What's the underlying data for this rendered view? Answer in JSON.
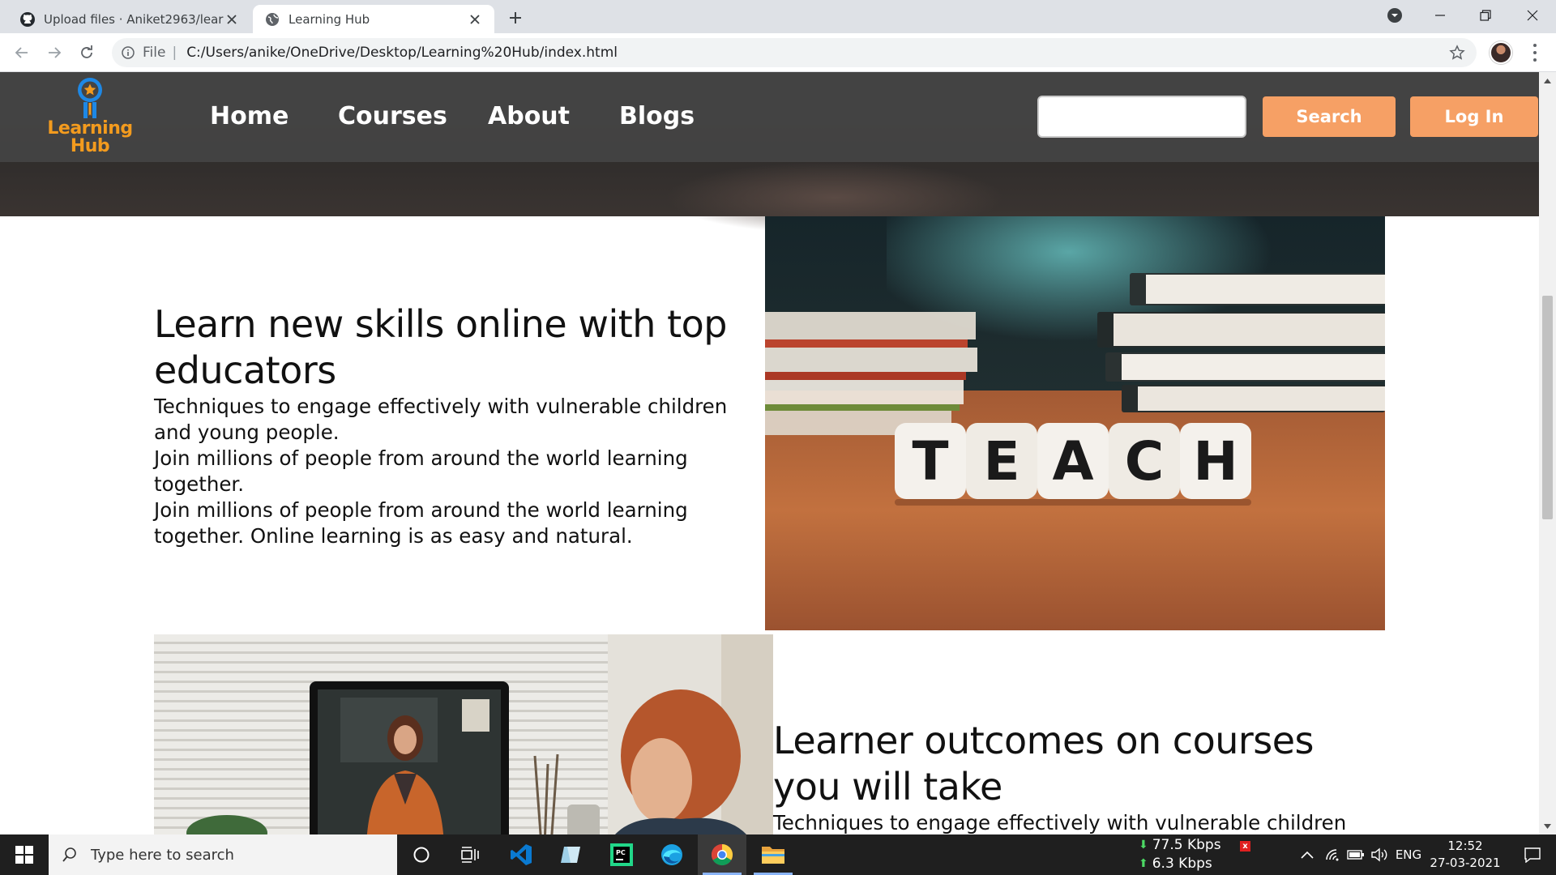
{
  "browser": {
    "tabs": [
      {
        "title": "Upload files · Aniket2963/learnin",
        "active": false,
        "favicon": "github-icon"
      },
      {
        "title": "Learning Hub",
        "active": true,
        "favicon": "globe-icon"
      }
    ],
    "address": {
      "scheme_label": "File",
      "url": "C:/Users/anike/OneDrive/Desktop/Learning%20Hub/index.html"
    }
  },
  "site": {
    "logo": {
      "line1": "Learning",
      "line2": "Hub"
    },
    "nav": [
      "Home",
      "Courses",
      "About",
      "Blogs"
    ],
    "search": {
      "value": "",
      "button_label": "Search"
    },
    "login_label": "Log In"
  },
  "sections": [
    {
      "heading": "Learn new skills online with top educators",
      "paragraphs": [
        "Techniques to engage effectively with vulnerable children and young people.",
        "Join millions of people from around the world learning together.",
        "Join millions of people from around the world learning together. Online learning is as easy and natural."
      ],
      "image_text": "TEACH"
    },
    {
      "heading": "Learner outcomes on courses you will take",
      "paragraphs": [
        "Techniques to engage effectively with vulnerable children"
      ]
    }
  ],
  "taskbar": {
    "search_placeholder": "Type here to search",
    "net_down": "77.5 Kbps",
    "net_up": "6.3 Kbps",
    "language": "ENG",
    "time": "12:52",
    "date": "27-03-2021"
  },
  "colors": {
    "accent_orange": "#f6a065",
    "logo_orange": "#f39b1e",
    "logo_blue": "#1e88e5",
    "nav_bg": "#444444"
  }
}
